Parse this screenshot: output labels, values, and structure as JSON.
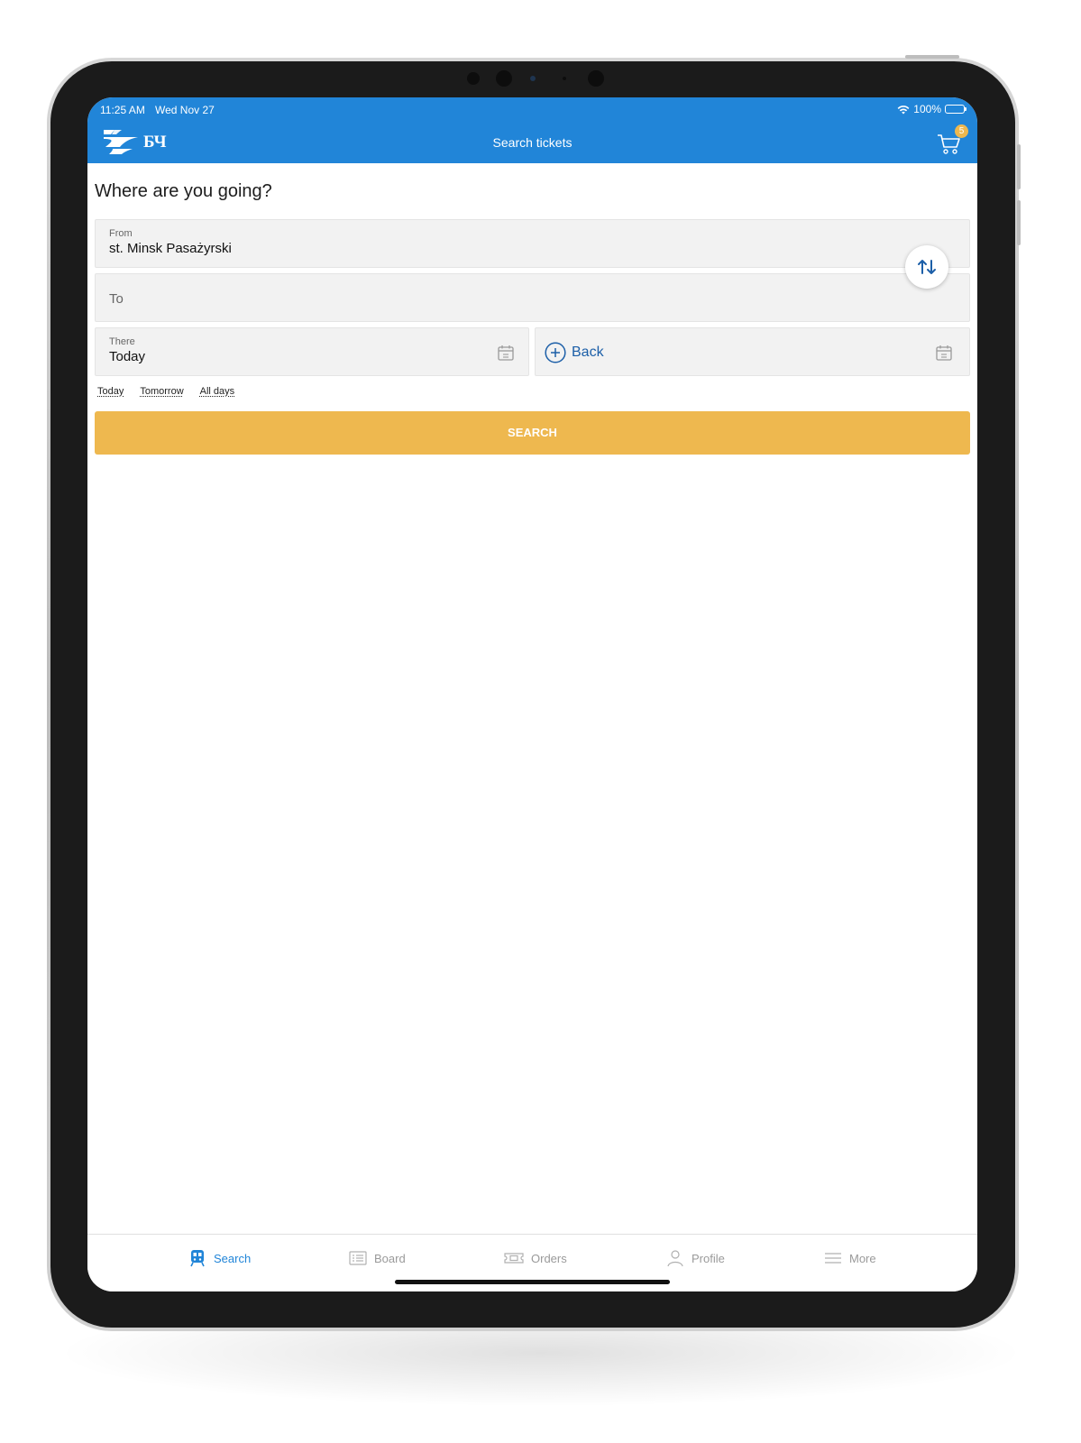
{
  "status_bar": {
    "time": "11:25 AM",
    "date": "Wed Nov 27",
    "battery": "100%"
  },
  "header": {
    "logo_text": "БЧ",
    "title": "Search tickets",
    "cart_count": "5"
  },
  "form": {
    "heading": "Where are you going?",
    "from": {
      "label": "From",
      "value": "st. Minsk Pasażyrski"
    },
    "to": {
      "placeholder": "To"
    },
    "there": {
      "label": "There",
      "value": "Today"
    },
    "back": {
      "label": "Back"
    },
    "quick_dates": [
      "Today",
      "Tomorrow",
      "All days"
    ],
    "search_label": "SEARCH"
  },
  "tabs": [
    {
      "label": "Search",
      "icon": "train-icon",
      "active": true
    },
    {
      "label": "Board",
      "icon": "board-icon",
      "active": false
    },
    {
      "label": "Orders",
      "icon": "ticket-icon",
      "active": false
    },
    {
      "label": "Profile",
      "icon": "user-icon",
      "active": false
    },
    {
      "label": "More",
      "icon": "menu-icon",
      "active": false
    }
  ],
  "colors": {
    "primary": "#2185d8",
    "accent": "#eeb84f",
    "link": "#1c5fa8"
  }
}
